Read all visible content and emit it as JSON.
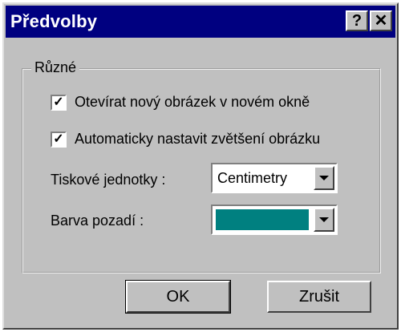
{
  "window": {
    "title": "Předvolby",
    "help_label": "?",
    "close_label": "✕"
  },
  "group": {
    "legend": "Různé",
    "options": [
      {
        "label": "Otevírat nový obrázek v novém okně",
        "checked": true,
        "mark": "✓"
      },
      {
        "label": "Automaticky nastavit zvětšení obrázku",
        "checked": true,
        "mark": "✓"
      }
    ],
    "print_units": {
      "label": "Tiskové jednotky :",
      "value": "Centimetry"
    },
    "background": {
      "label": "Barva pozadí :",
      "color": "#008080"
    }
  },
  "buttons": {
    "ok": "OK",
    "cancel": "Zrušit"
  }
}
